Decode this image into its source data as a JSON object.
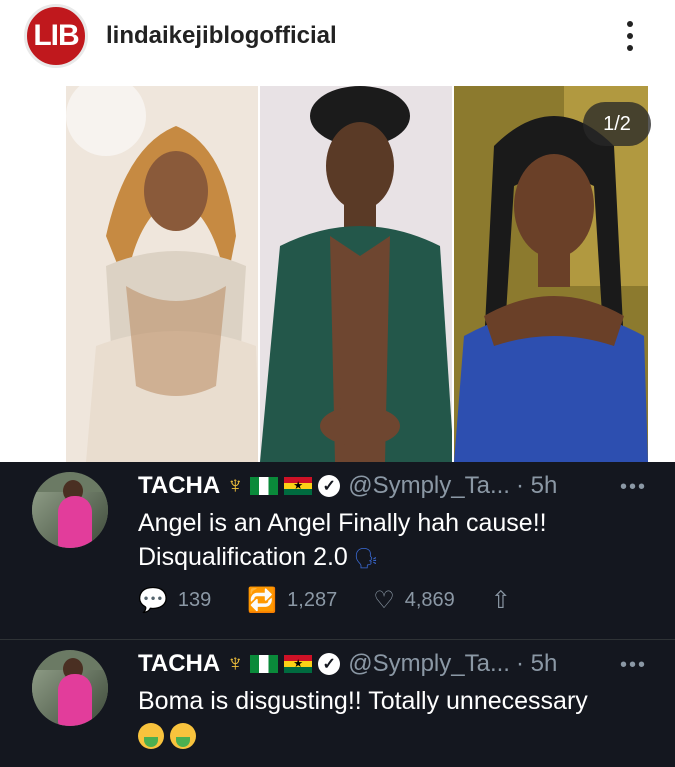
{
  "post": {
    "account": "lindaikejiblogofficial",
    "logo_text": "LIB",
    "carousel_counter": "1/2"
  },
  "tweets": [
    {
      "name": "TACHA",
      "handle": "@Symply_Ta...",
      "time": "· 5h",
      "text": "Angel is an Angel Finally hah cause!! Disqualification 2.0",
      "replies": "139",
      "retweets": "1,287",
      "likes": "4,869"
    },
    {
      "name": "TACHA",
      "handle": "@Symply_Ta...",
      "time": "· 5h",
      "text": "Boma is disgusting!! Totally unnecessary"
    }
  ],
  "colors": {
    "tweet_bg": "#14171f",
    "logo_red": "#c0181d",
    "muted": "#8b98a5"
  },
  "icons": [
    "more-vertical-icon",
    "more-horizontal-icon",
    "reply-icon",
    "retweet-icon",
    "like-icon",
    "share-icon",
    "verified-icon",
    "trident-icon",
    "flag-nigeria-icon",
    "flag-ghana-icon"
  ]
}
